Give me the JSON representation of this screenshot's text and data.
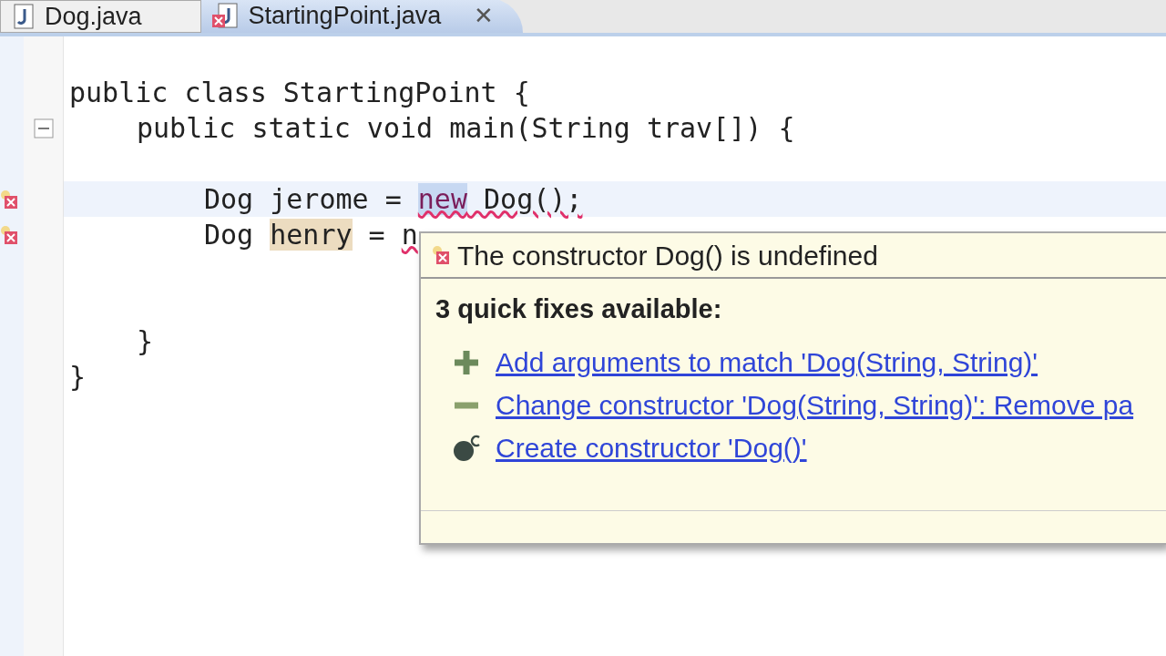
{
  "tabs": [
    {
      "label": "Dog.java",
      "selected": false,
      "error": false
    },
    {
      "label": "StartingPoint.java",
      "selected": true,
      "error": true,
      "close": "✕"
    }
  ],
  "editor": {
    "lines": [
      {
        "kind": "code",
        "current": false,
        "error": false,
        "segments": [
          {
            "text": "public class StartingPoint {",
            "selected": false,
            "error": false,
            "highlighted": false
          }
        ],
        "children": [
          {
            "kind": "code",
            "current": false,
            "error": false,
            "expanded": true,
            "segments": [
              {
                "text": "public static void main(String trav[]) {",
                "selected": false,
                "error": false,
                "highlighted": false
              }
            ],
            "children": [
              {
                "kind": "blank"
              },
              {
                "kind": "code",
                "current": true,
                "error": true,
                "segments": [
                  {
                    "text": "Dog jerome = ",
                    "selected": false,
                    "error": false,
                    "highlighted": false
                  },
                  {
                    "text": "new",
                    "selected": true,
                    "error": true,
                    "highlighted": false
                  },
                  {
                    "text": " Dog();",
                    "selected": false,
                    "error": true,
                    "highlighted": false
                  }
                ]
              },
              {
                "kind": "code",
                "current": false,
                "error": true,
                "segments": [
                  {
                    "text": "Dog ",
                    "selected": false,
                    "error": false,
                    "highlighted": false
                  },
                  {
                    "text": "henry",
                    "selected": false,
                    "error": false,
                    "highlighted": true
                  },
                  {
                    "text": " = ",
                    "selected": false,
                    "error": false,
                    "highlighted": false
                  },
                  {
                    "text": "n",
                    "selected": false,
                    "error": true,
                    "highlighted": false
                  }
                ]
              },
              {
                "kind": "blank"
              },
              {
                "kind": "blank"
              }
            ]
          },
          {
            "kind": "code",
            "current": false,
            "error": false,
            "segments": [
              {
                "text": "}",
                "selected": false,
                "error": false,
                "highlighted": false
              }
            ]
          }
        ]
      },
      {
        "kind": "code",
        "current": false,
        "error": false,
        "segments": [
          {
            "text": "}",
            "selected": false,
            "error": false,
            "highlighted": false
          }
        ]
      }
    ]
  },
  "hover_popup": {
    "title": "The constructor Dog() is undefined",
    "subtitle": "3 quick fixes available:",
    "fixes": [
      {
        "kind": "add",
        "label": "Add arguments to match 'Dog(String, String)'"
      },
      {
        "kind": "remove",
        "label": "Change constructor 'Dog(String, String)': Remove pa"
      },
      {
        "kind": "constructor",
        "label": "Create constructor 'Dog()'"
      }
    ]
  }
}
